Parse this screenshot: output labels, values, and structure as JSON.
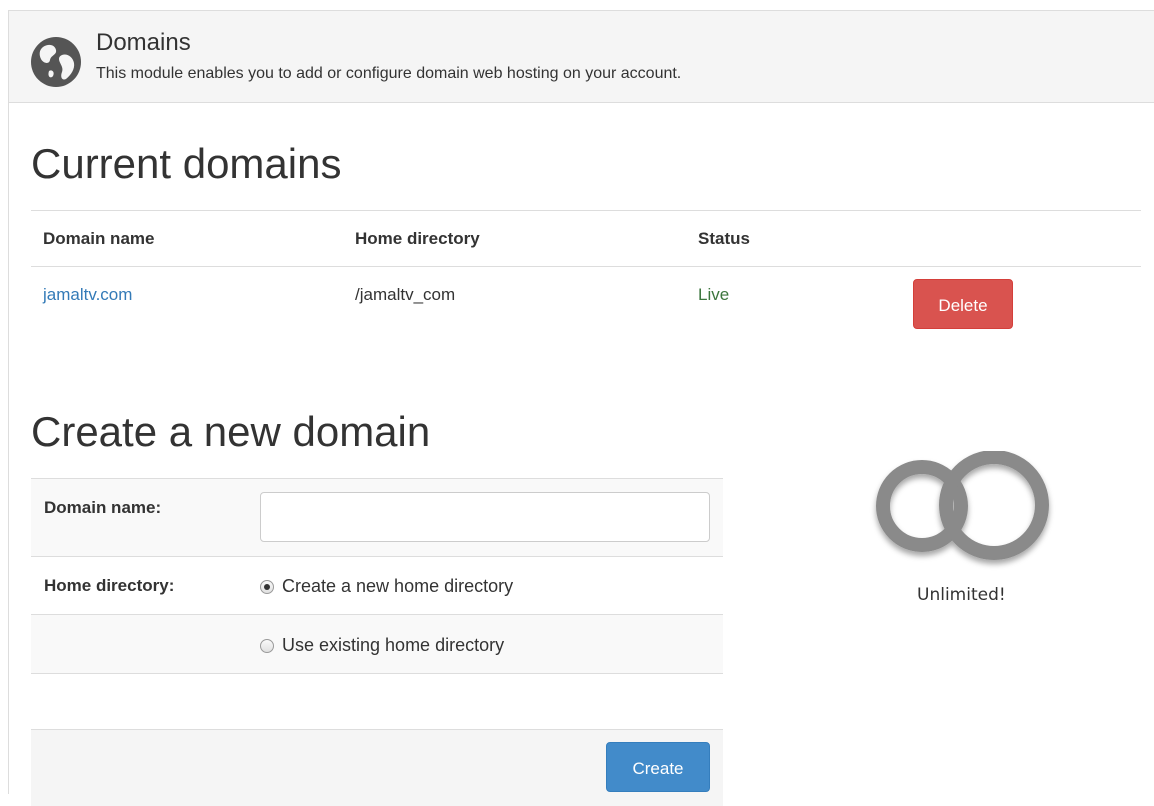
{
  "header": {
    "title": "Domains",
    "description": "This module enables you to add or configure domain web hosting on your account.",
    "icon": "globe-icon"
  },
  "current_domains": {
    "heading": "Current domains",
    "columns": [
      "Domain name",
      "Home directory",
      "Status"
    ],
    "rows": [
      {
        "domain": "jamaltv.com",
        "home_directory": "/jamaltv_com",
        "status": "Live",
        "action": "Delete"
      }
    ]
  },
  "create_domain": {
    "heading": "Create a new domain",
    "domain_label": "Domain name:",
    "domain_value": "",
    "home_dir_label": "Home directory:",
    "options": [
      {
        "label": "Create a new home directory",
        "checked": true
      },
      {
        "label": "Use existing home directory",
        "checked": false
      }
    ],
    "submit_label": "Create"
  },
  "quota": {
    "icon": "infinity-icon",
    "label": "Unlimited!"
  },
  "colors": {
    "link": "#337ab7",
    "live": "#3c763d",
    "danger": "#d9534f",
    "primary": "#428bca"
  }
}
